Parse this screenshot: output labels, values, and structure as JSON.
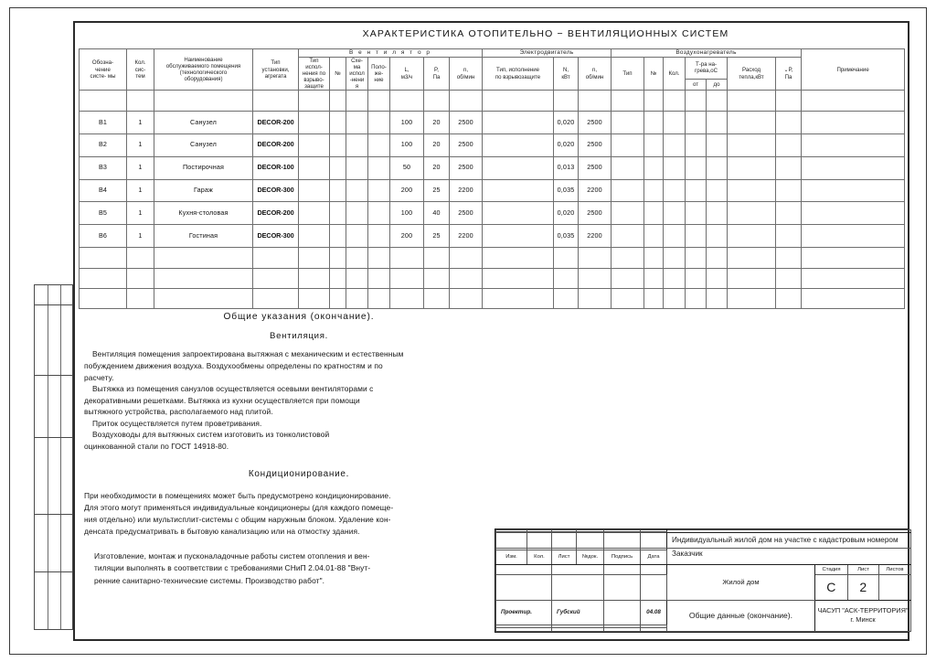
{
  "drawing": {
    "title": "ХАРАКТЕРИСТИКА ОТОПИТЕЛЬНО − ВЕНТИЛЯЦИОННЫХ СИСТЕМ"
  },
  "table": {
    "groups": {
      "fan": "В е н т и л я т о р",
      "motor": "Электродвигатель",
      "heater": "Воздухонагреватель"
    },
    "headers": {
      "designation": "Обозна-\nчение\nсисте- мы",
      "designation_l1": "Обозна-",
      "designation_l2": "чение",
      "designation_l3": "систе- мы",
      "count_l1": "Кол.",
      "count_l2": "сис-",
      "count_l3": "тем",
      "room_l1": "Наименование",
      "room_l2": "обслуживаемого помещения",
      "room_l3": "(технологического",
      "room_l4": "оборудования)",
      "unit_l1": "Тип",
      "unit_l2": "установки,",
      "unit_l3": "агрегата",
      "fan_exproof_l1": "Тип",
      "fan_exproof_l2": "испол-",
      "fan_exproof_l3": "нения по",
      "fan_exproof_l4": "взрыво-",
      "fan_exproof_l5": "защите",
      "fan_no": "№",
      "fan_scheme_l1": "Схе-",
      "fan_scheme_l2": "ма",
      "fan_scheme_l3": "испол",
      "fan_scheme_l4": "-нени",
      "fan_scheme_l5": "я",
      "fan_pos_l1": "Поло-",
      "fan_pos_l2": "же-",
      "fan_pos_l3": "ние",
      "fan_L_l1": "L,",
      "fan_L_l2": "м3/ч",
      "fan_P_l1": "P,",
      "fan_P_l2": "Па",
      "fan_n_l1": "n,",
      "fan_n_l2": "об/мин",
      "motor_type_l1": "Тип, исполнение",
      "motor_type_l2": "по взрывозащите",
      "motor_N_l1": "N,",
      "motor_N_l2": "кВт",
      "motor_n_l1": "n,",
      "motor_n_l2": "об/мин",
      "heater_type": "Тип",
      "heater_no": "№",
      "heater_count": "Кол.",
      "heater_temp_l1": "Т-ра на-",
      "heater_temp_l2": "грева,оС",
      "heater_temp_from": "от",
      "heater_temp_to": "до",
      "heater_Q_l1": "Расход",
      "heater_Q_l2": "тепла,кВт",
      "heater_dP_l1": "⌄P,",
      "heater_dP_l2": "Па",
      "notes": "Примечание"
    },
    "rows": [
      {
        "sys": "В1",
        "qty": "1",
        "room": "Санузел",
        "unit": "DECOR-200",
        "L": "100",
        "P": "20",
        "n": "2500",
        "N": "0,020",
        "mn": "2500"
      },
      {
        "sys": "В2",
        "qty": "1",
        "room": "Санузел",
        "unit": "DECOR-200",
        "L": "100",
        "P": "20",
        "n": "2500",
        "N": "0,020",
        "mn": "2500"
      },
      {
        "sys": "В3",
        "qty": "1",
        "room": "Постирочная",
        "unit": "DECOR-100",
        "L": "50",
        "P": "20",
        "n": "2500",
        "N": "0,013",
        "mn": "2500"
      },
      {
        "sys": "В4",
        "qty": "1",
        "room": "Гараж",
        "unit": "DECOR-300",
        "L": "200",
        "P": "25",
        "n": "2200",
        "N": "0,035",
        "mn": "2200"
      },
      {
        "sys": "В5",
        "qty": "1",
        "room": "Кухня-столовая",
        "unit": "DECOR-200",
        "L": "100",
        "P": "40",
        "n": "2500",
        "N": "0,020",
        "mn": "2500"
      },
      {
        "sys": "В6",
        "qty": "1",
        "room": "Гостиная",
        "unit": "DECOR-300",
        "L": "200",
        "P": "25",
        "n": "2200",
        "N": "0,035",
        "mn": "2200"
      }
    ]
  },
  "notes": {
    "heading": "Общие указания (окончание).",
    "subheading": "Вентиляция.",
    "p1": "Вентиляция помещения запроектирована вытяжная с механическим и естественным",
    "p2": "побуждением движения воздуха. Воздухообмены определены по кратностям и по",
    "p3": "расчету.",
    "p4": "Вытяжка из помещения санузлов осуществляется осевыми вентиляторами с",
    "p5": "декоративными решетками. Вытяжка из кухни осуществляется при помощи",
    "p6": "вытяжного устройства, располагаемого над плитой.",
    "p7": "Приток осуществляется путем проветривания.",
    "p8": "Воздуховоды для вытяжных систем изготовить из тонколистовой",
    "p9": "оцинкованной стали по ГОСТ 14918-80."
  },
  "notes2": {
    "subheading": "Кондиционирование.",
    "p1": "При необходимости в помещениях может быть предусмотрено кондиционирование.",
    "p2": "Для этого могут применяться индивидуальные кондиционеры (для каждого помеще-",
    "p3": "ния отдельно) или мультисплит-системы с общим наружным блоком. Удаление кон-",
    "p4": "денсата предусматривать в бытовую канализацию или на отмостку здания.",
    "p5": "Изготовление, монтаж и пусконаладочные работы систем отопления и вен-",
    "p6": "тиляции выполнять в соответствии с требованиями СНиП 2.04.01-88 \"Внут-",
    "p7": "ренние санитарно-технические системы. Производство работ\"."
  },
  "stamp": {
    "rev_headers": [
      "Изм.",
      "Кол.",
      "Лист",
      "№док.",
      "Подпись",
      "Дата"
    ],
    "role": "Проектир.",
    "name": "Губский",
    "date": "04.08",
    "object_line": "Индивидуальный жилой дом на участке с кадастровым номером",
    "customer_label": "Заказчик",
    "building": "Жилой дом",
    "stage_label": "Стадия",
    "sheet_label": "Лист",
    "sheets_label": "Листов",
    "stage_value": "С",
    "sheet_value": "2",
    "sheets_value": "",
    "section_title": "Общие данные (окончание).",
    "org_line1": "ЧАСУП \"АСК-ТЕРРИТОРИЯ\"",
    "org_line2": "г. Минск"
  },
  "colors": {
    "frame": "#1e1e1e",
    "grid": "#6e6e6e",
    "text": "#1a1a1a",
    "paper": "#ffffff"
  }
}
